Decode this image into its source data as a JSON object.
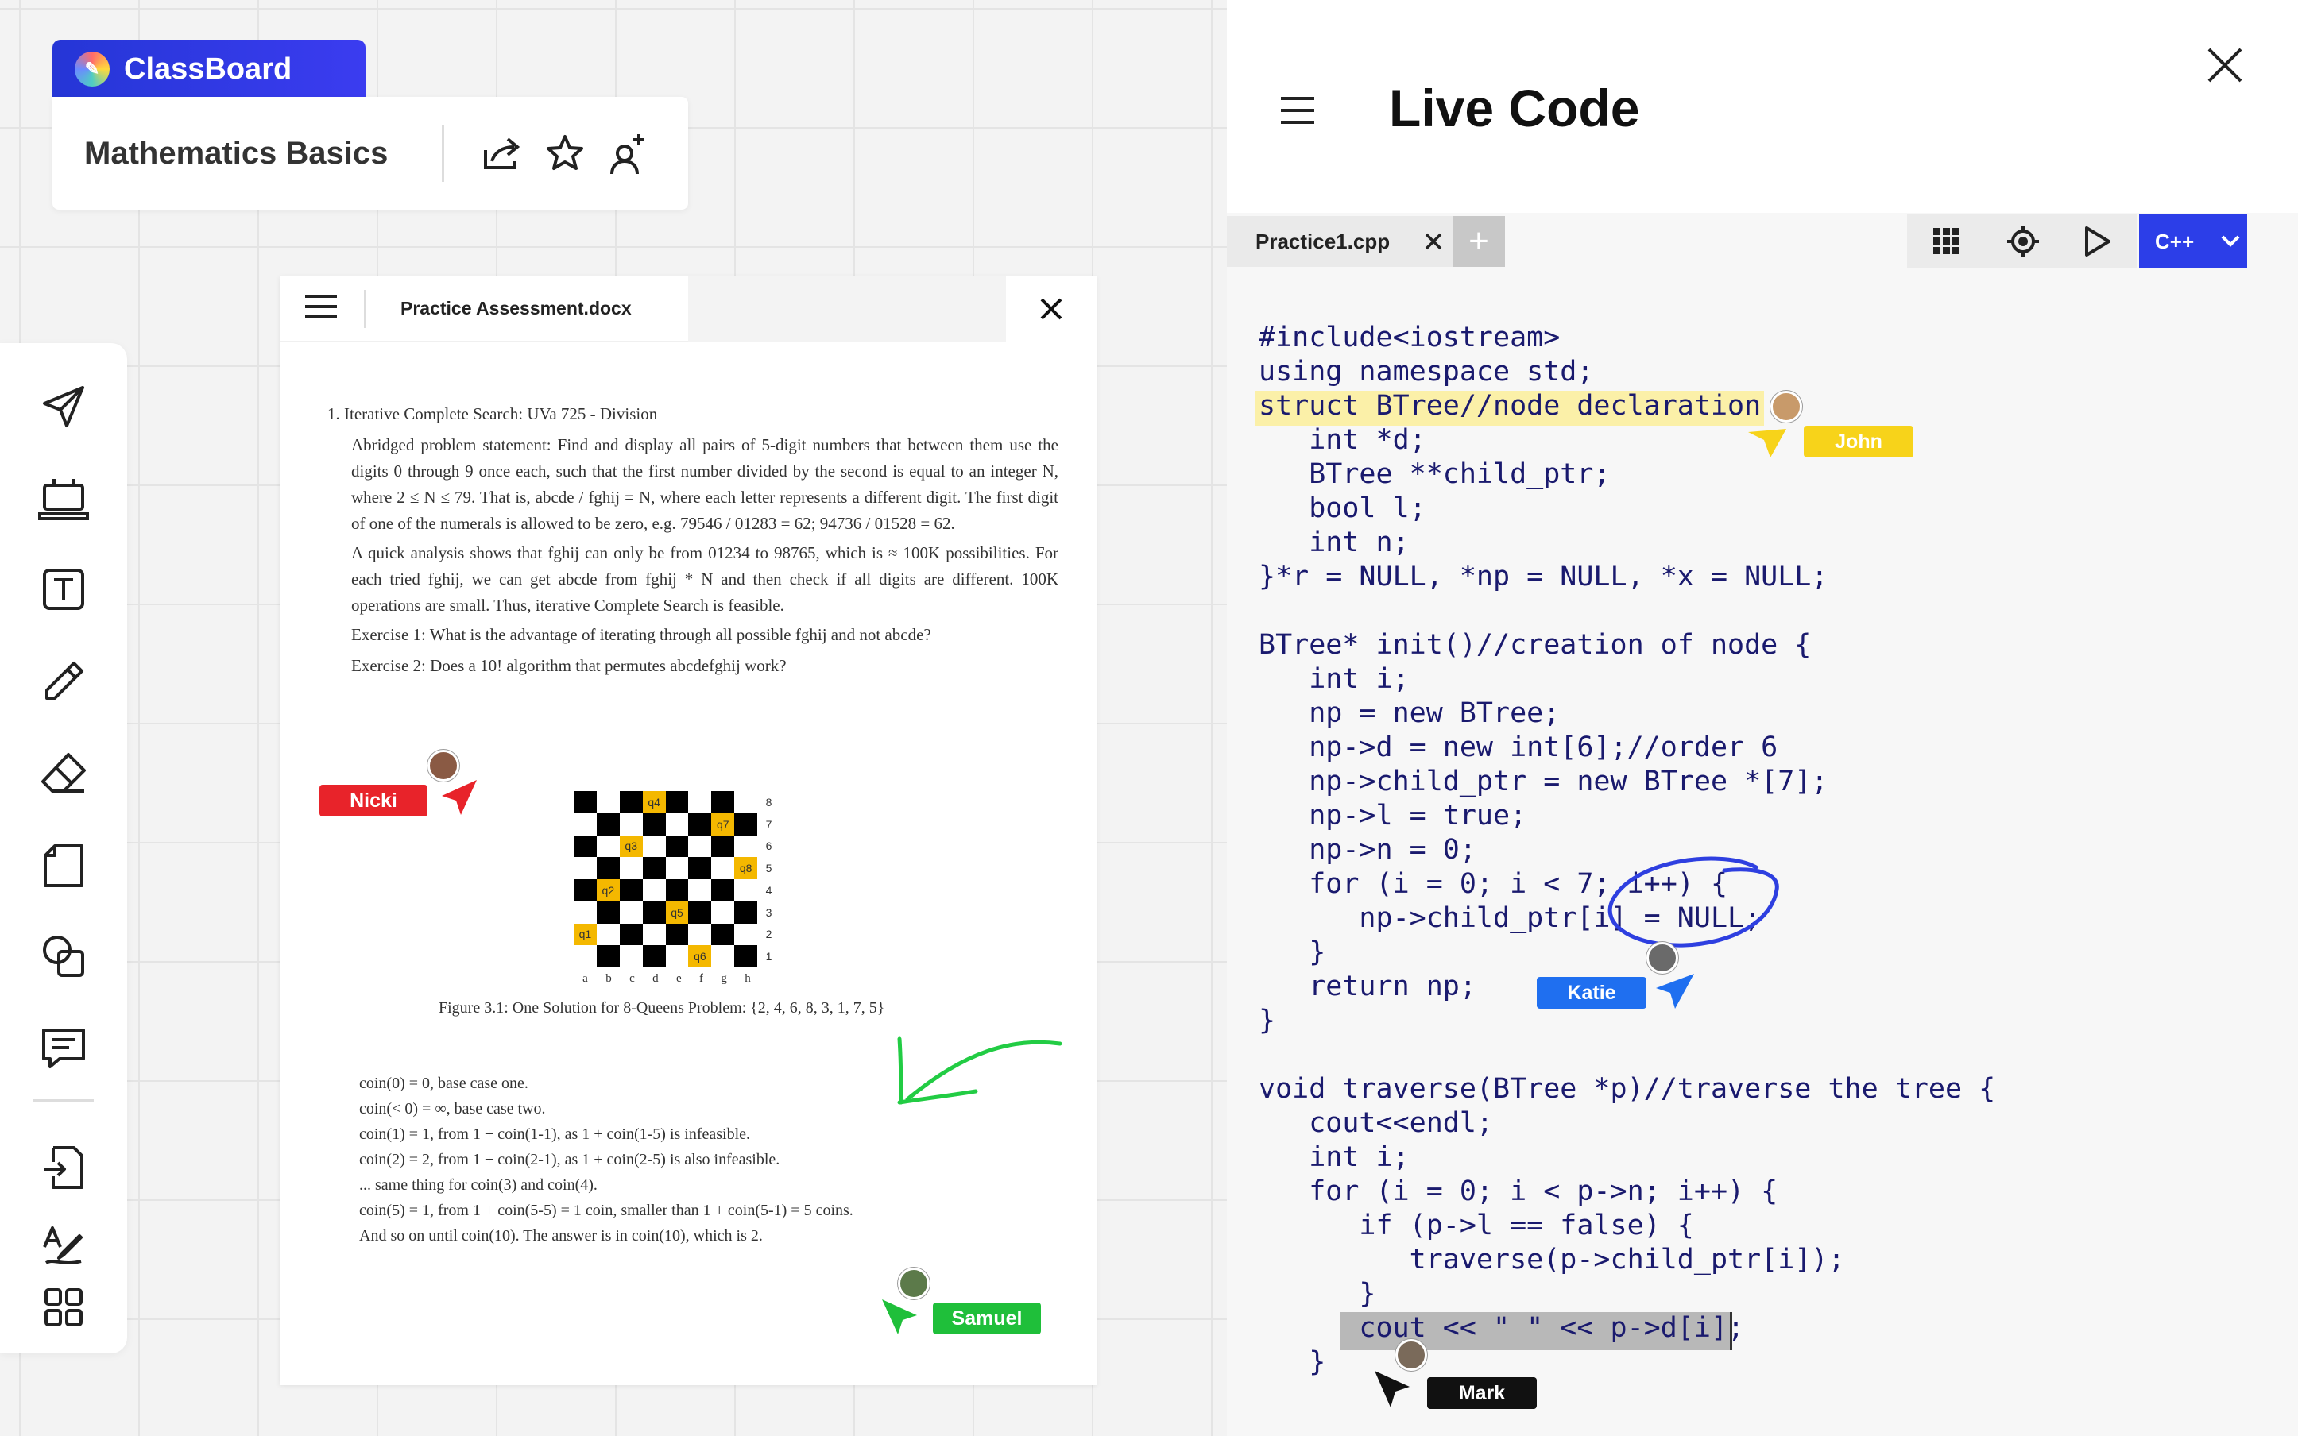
{
  "app": {
    "name": "ClassBoard"
  },
  "board": {
    "title": "Mathematics Basics"
  },
  "toolbar": {
    "items": [
      "send-icon",
      "laptop-icon",
      "text-icon",
      "pencil-icon",
      "eraser-icon",
      "page-icon",
      "shapes-icon",
      "comment-icon",
      "import-icon",
      "handwriting-icon",
      "apps-icon"
    ]
  },
  "document": {
    "filename": "Practice Assessment.docx",
    "heading": "1.  Iterative Complete Search: UVa 725 - Division",
    "para1": "Abridged problem statement: Find and display all pairs of 5-digit numbers that between them use the digits 0 through 9 once each, such that the first number divided by the second is equal to an integer N, where 2 ≤ N ≤ 79. That is, abcde / fghij = N, where each letter represents a different digit. The first digit of one of the numerals is allowed to be zero, e.g. 79546 / 01283 = 62; 94736 / 01528 = 62.",
    "para2": "A quick analysis shows that fghij can only be from 01234 to 98765, which is ≈ 100K possibilities. For each tried fghij, we can get abcde from fghij * N and then check if all digits are different. 100K operations are small. Thus, iterative Complete Search is feasible.",
    "ex1": "Exercise 1: What is the advantage of iterating through all possible fghij and not abcde?",
    "ex2": "Exercise 2: Does a 10! algorithm that permutes abcdefghij work?",
    "caption": "Figure 3.1: One Solution for 8-Queens Problem: {2, 4, 6, 8, 3, 1, 7, 5}",
    "coin_lines": [
      "coin(0) = 0, base case one.",
      "coin(< 0) = ∞, base case two.",
      "coin(1) = 1, from 1 + coin(1-1), as 1 + coin(1-5) is infeasible.",
      "coin(2) = 2, from 1 + coin(2-1), as 1 + coin(2-5) is also infeasible.",
      "... same thing for coin(3) and coin(4).",
      "coin(5) = 1, from 1 + coin(5-5) = 1 coin, smaller than 1 + coin(5-1) = 5 coins.",
      "And so on until coin(10). The answer is in coin(10), which is 2."
    ],
    "board_ranks": [
      "8",
      "7",
      "6",
      "5",
      "4",
      "3",
      "2",
      "1"
    ],
    "board_files": [
      "a",
      "b",
      "c",
      "d",
      "e",
      "f",
      "g",
      "h"
    ],
    "queens": [
      "q4",
      "q7",
      "q3",
      "q8",
      "q2",
      "q5",
      "q1",
      "q6"
    ]
  },
  "live_code": {
    "title": "Live Code",
    "tab": "Practice1.cpp",
    "language": "C++",
    "code": "#include<iostream>\nusing namespace std;\nstruct BTree//node declaration {\n   int *d;\n   BTree **child_ptr;\n   bool l;\n   int n;\n}*r = NULL, *np = NULL, *x = NULL;\n\nBTree* init()//creation of node {\n   int i;\n   np = new BTree;\n   np->d = new int[6];//order 6\n   np->child_ptr = new BTree *[7];\n   np->l = true;\n   np->n = 0;\n   for (i = 0; i < 7; i++) {\n      np->child_ptr[i] = NULL;\n   }\n   return np;\n}\n\nvoid traverse(BTree *p)//traverse the tree {\n   cout<<endl;\n   int i;\n   for (i = 0; i < p->n; i++) {\n      if (p->l == false) {\n         traverse(p->child_ptr[i]);\n      }\n      cout << \" \" << p->d[i];\n   }"
  },
  "collaborators": [
    {
      "name": "Nicki",
      "color": "#e8232a"
    },
    {
      "name": "Samuel",
      "color": "#1fbf3a"
    },
    {
      "name": "John",
      "color": "#f7d31a"
    },
    {
      "name": "Katie",
      "color": "#1f6ff0"
    },
    {
      "name": "Mark",
      "color": "#111111"
    }
  ]
}
